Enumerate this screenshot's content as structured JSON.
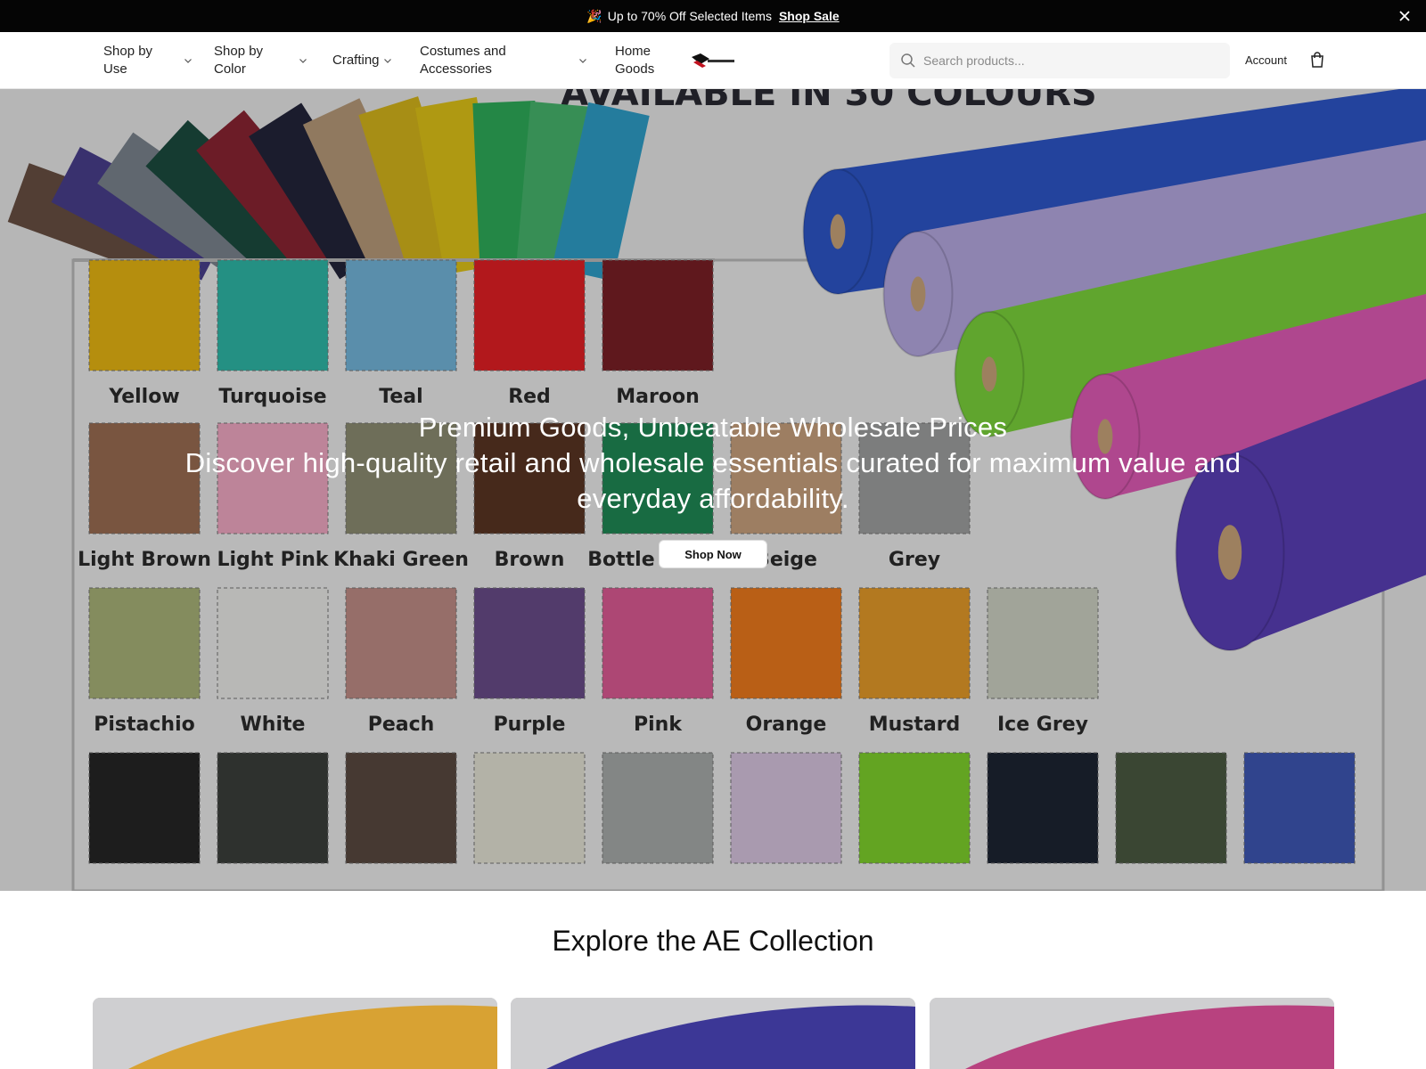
{
  "announcement": {
    "emoji": "🎉",
    "text": "Up to 70% Off Selected Items",
    "link_label": "Shop Sale"
  },
  "nav": {
    "items": [
      {
        "label_line1": "Shop by",
        "label_line2": "Use"
      },
      {
        "label_line1": "Shop by",
        "label_line2": "Color"
      },
      {
        "label_line1": "Crafting",
        "label_line2": ""
      },
      {
        "label_line1": "Costumes and",
        "label_line2": "Accessories"
      },
      {
        "label_line1": "Home",
        "label_line2": "Goods"
      }
    ],
    "search_placeholder": "Search products...",
    "account_label": "Account"
  },
  "hero": {
    "art_heading": "AVAILABLE IN 30 COLOURS",
    "title": "Premium Goods, Unbeatable Wholesale Prices",
    "subtitle": "Discover high-quality retail and wholesale essentials curated for maximum value and everyday affordability.",
    "button_label": "Shop Now",
    "swatches": [
      {
        "name": "Yellow",
        "color": "#e8b713"
      },
      {
        "name": "Turquoise",
        "color": "#2fb9a8"
      },
      {
        "name": "Teal",
        "color": "#74b7dc"
      },
      {
        "name": "Red",
        "color": "#e51f24"
      },
      {
        "name": "Maroon",
        "color": "#7a1f26"
      },
      {
        "name": "Light Brown",
        "color": "#9b6e52"
      },
      {
        "name": "Light Pink",
        "color": "#f3a9c4"
      },
      {
        "name": "Khaki Green",
        "color": "#8d8d72"
      },
      {
        "name": "Brown",
        "color": "#5a3523"
      },
      {
        "name": "Bottle Green",
        "color": "#1f8a55"
      },
      {
        "name": "Beige",
        "color": "#c9a27e"
      },
      {
        "name": "Grey",
        "color": "#9fa0a0"
      },
      {
        "name": "Pistachio",
        "color": "#a9b479"
      },
      {
        "name": "White",
        "color": "#ececea"
      },
      {
        "name": "Peach",
        "color": "#c08d87"
      },
      {
        "name": "Purple",
        "color": "#6a4c8a"
      },
      {
        "name": "Pink",
        "color": "#de5b95"
      },
      {
        "name": "Orange",
        "color": "#ee7a1d"
      },
      {
        "name": "Mustard",
        "color": "#e69c2a"
      },
      {
        "name": "Ice Grey",
        "color": "#cfd3c5"
      }
    ],
    "bottom_swatch_colors": [
      "#262626",
      "#3b3f3c",
      "#5a4a40",
      "#e6e4d6",
      "#a8acab",
      "#d9c6e0",
      "#7fd32c",
      "#1d2433",
      "#4b5a42",
      "#3e58b5"
    ],
    "fan_colors": [
      "#6a5043",
      "#4a3f8d",
      "#7b848f",
      "#1c4c3f",
      "#8b2433",
      "#23253a",
      "#b99c7a",
      "#d7b71b",
      "#e0c418",
      "#2fae5a",
      "#47b76d",
      "#2f9fc9"
    ],
    "roll_colors": [
      "#2d56c9",
      "#b6a9e2",
      "#7bd43c",
      "#e05bb6",
      "#5a3fb8"
    ]
  },
  "collection": {
    "title": "Explore the AE Collection",
    "cards": [
      {
        "name": "card-mustard",
        "color": "#d8a233"
      },
      {
        "name": "card-royal-blue",
        "color": "#3c3796"
      },
      {
        "name": "card-magenta",
        "color": "#b8427f"
      }
    ]
  }
}
